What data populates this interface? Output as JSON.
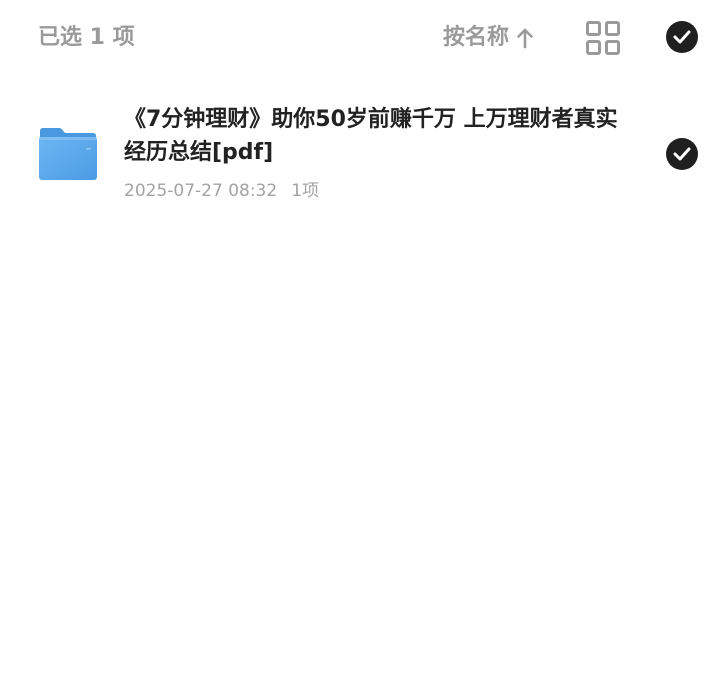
{
  "header": {
    "selected_text": "已选 1 项",
    "sort_label": "按名称",
    "sort_direction_icon": "arrow-up-icon",
    "view_icon": "grid-view-icon",
    "select_all_icon": "check-circle-icon"
  },
  "files": [
    {
      "icon": "folder-icon",
      "name": "《7分钟理财》助你50岁前赚千万 上万理财者真实经历总结[pdf]",
      "date": "2025-07-27 08:32",
      "count": "1项",
      "selected": true
    }
  ],
  "colors": {
    "check_fill": "#1f1f1f",
    "muted_text": "#9a9a9a",
    "folder_blue": "#5aa6ea"
  }
}
